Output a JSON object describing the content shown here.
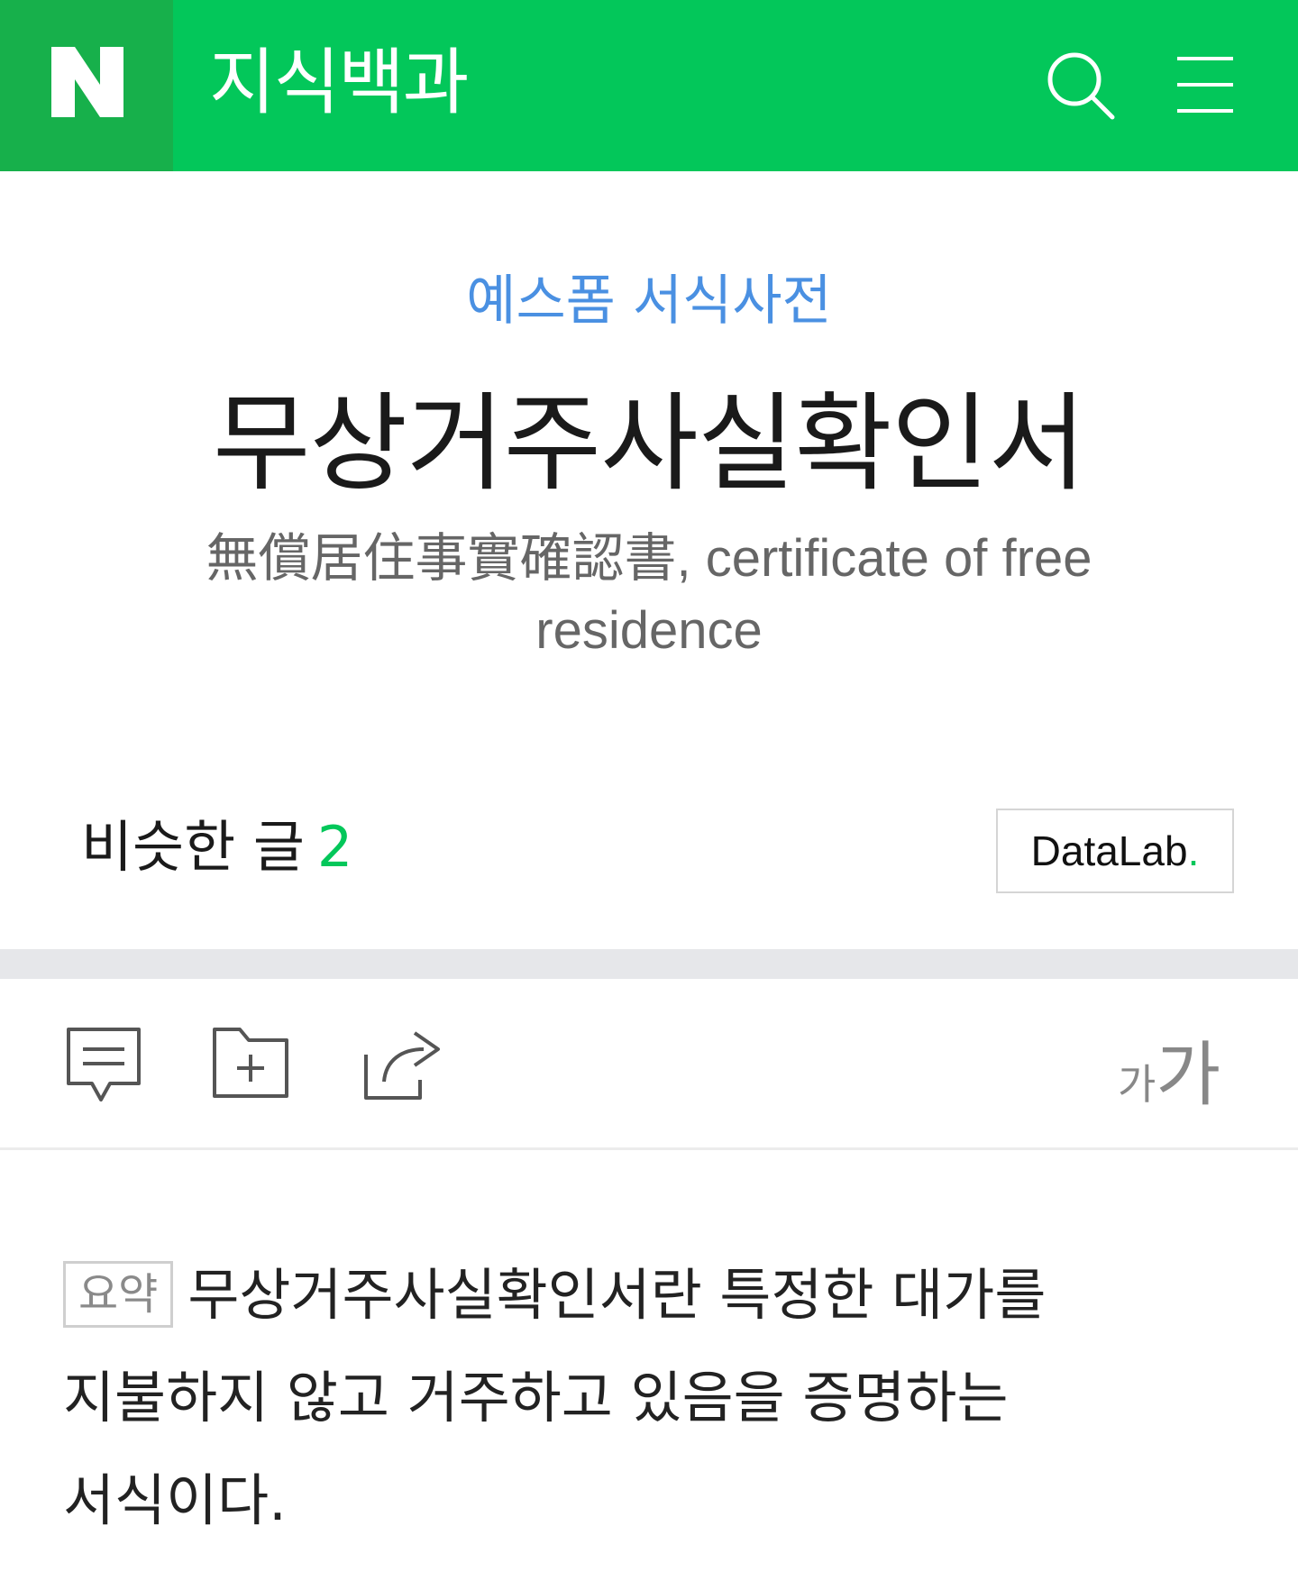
{
  "header": {
    "logo_letter": "N",
    "title": "지식백과",
    "search_icon": "search-icon",
    "menu_icon": "menu-icon"
  },
  "document": {
    "category": "예스폼 서식사전",
    "title": "무상거주사실확인서",
    "subtitle": "無償居住事實確認書, certificate of free residence"
  },
  "similar": {
    "label": "비슷한 글",
    "count": "2"
  },
  "datalab": {
    "label": "DataLab",
    "dot": "."
  },
  "toolbar": {
    "icons": [
      "comment-icon",
      "folder-add-icon",
      "share-icon"
    ],
    "font_small": "가",
    "font_big": "가"
  },
  "summary": {
    "badge": "요약",
    "text": "무상거주사실확인서란 특정한 대가를 지불하지 않고 거주하고 있음을 증명하는 서식이다."
  },
  "colors": {
    "brand_green": "#03c75a",
    "logo_block_green": "#17b04b",
    "category_blue": "#4a90e2"
  }
}
